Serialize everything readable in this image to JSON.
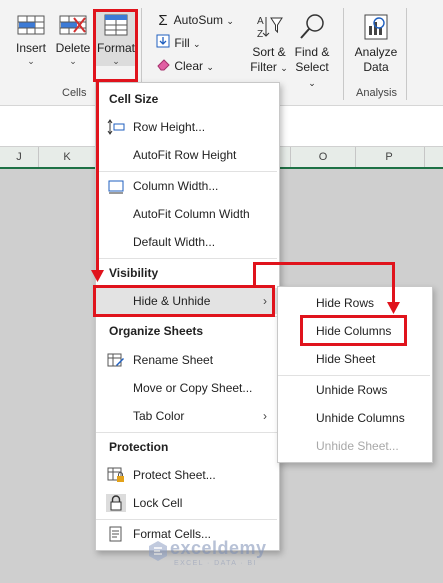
{
  "ribbon": {
    "cells_group": {
      "insert_label": "Insert",
      "delete_label": "Delete",
      "format_label": "Format",
      "group_label": "Cells"
    },
    "editing_group": {
      "autosum_label": "AutoSum",
      "fill_label": "Fill",
      "clear_label": "Clear",
      "sort_line1": "Sort &",
      "sort_line2": "Filter",
      "find_line1": "Find &",
      "find_line2": "Select"
    },
    "analysis_group": {
      "analyze_line1": "Analyze",
      "analyze_line2": "Data",
      "group_label": "Analysis"
    }
  },
  "sheet": {
    "columns": [
      "J",
      "K",
      "O",
      "P"
    ],
    "header_color": "#e7ece8",
    "accent": "#1e7145"
  },
  "format_menu": {
    "cell_size_heading": "Cell Size",
    "row_height": "Row Height...",
    "autofit_row_height": "AutoFit Row Height",
    "column_width": "Column Width...",
    "autofit_column_width": "AutoFit Column Width",
    "default_width": "Default Width...",
    "visibility_heading": "Visibility",
    "hide_unhide": "Hide & Unhide",
    "organize_heading": "Organize Sheets",
    "rename_sheet": "Rename Sheet",
    "move_copy_sheet": "Move or Copy Sheet...",
    "tab_color": "Tab Color",
    "protection_heading": "Protection",
    "protect_sheet": "Protect Sheet...",
    "lock_cell": "Lock Cell",
    "format_cells": "Format Cells..."
  },
  "hide_unhide_submenu": {
    "hide_rows": "Hide Rows",
    "hide_columns": "Hide Columns",
    "hide_sheet": "Hide Sheet",
    "unhide_rows": "Unhide Rows",
    "unhide_columns": "Unhide Columns",
    "unhide_sheet": "Unhide Sheet..."
  },
  "watermark": {
    "brand": "exceldemy",
    "tagline": "EXCEL · DATA · BI"
  },
  "annotation_color": "#e0131c"
}
